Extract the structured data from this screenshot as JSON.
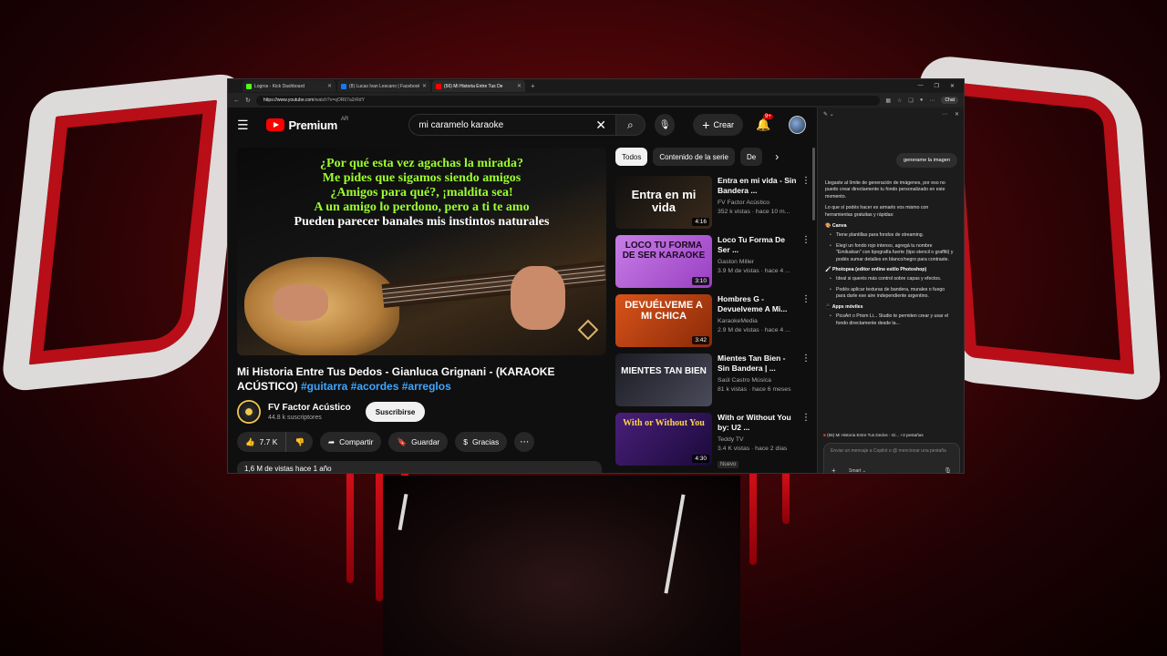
{
  "browser": {
    "tabs": [
      {
        "title": "Logros - Kick Dashboard",
        "favicon_color": "#53fc18",
        "active": false
      },
      {
        "title": "(8) Lucas Ivan Lescano | Facebook",
        "favicon_color": "#1877f2",
        "active": false
      },
      {
        "title": "(56) Mi Historia Entre Tus De",
        "favicon_color": "#ff0000",
        "active": true
      }
    ],
    "url_host": "https://www.youtube.com",
    "url_path": "/watch?v=qOR67a2rRdY",
    "chat_label": "Chat",
    "new_tab": "+"
  },
  "youtube": {
    "logo_word": "Premium",
    "region": "AR",
    "search_value": "mi caramelo karaoke",
    "create_label": "Crear",
    "notifications_badge": "9+",
    "video": {
      "lyrics": [
        {
          "text": "¿Por qué esta vez agachas la mirada?",
          "color": "yellow"
        },
        {
          "text": "Me pides que sigamos siendo amigos",
          "color": "yellow"
        },
        {
          "text": "¿Amigos para qué?, ¡maldita sea!",
          "color": "yellow"
        },
        {
          "text": "A un amigo lo perdono, pero a ti te amo",
          "color": "mixed"
        },
        {
          "text": "Pueden parecer banales mis instintos naturales",
          "color": "white"
        }
      ],
      "title_main": "Mi Historia Entre Tus Dedos - Gianluca Grignani - (KARAOKE ACÚSTICO) ",
      "hashtags": "#guitarra #acordes #arreglos",
      "channel": "FV Factor Acústico",
      "subscribers": "44.8 k suscriptores",
      "subscribe_label": "Suscribirse",
      "likes": "7.7 K",
      "share_label": "Compartir",
      "save_label": "Guardar",
      "thanks_label": "Gracias",
      "views_date": "1,6 M de vistas  hace 1 año"
    },
    "chips": [
      "Todos",
      "Contenido de la serie",
      "De"
    ],
    "recommendations": [
      {
        "title": "Entra en mi vida - Sin Bandera ...",
        "channel": "FV Factor Acústico",
        "meta": "352 k vistas · hace 10 m...",
        "duration": "4:16",
        "thumb_text": "Entra en mi vida",
        "thumb_bg": "#1a1a1a",
        "thumb_fg": "#ffffff"
      },
      {
        "title": "Loco Tu Forma De Ser ...",
        "channel": "Gaston Miller",
        "meta": "3.9 M de vistas · hace 4 ...",
        "duration": "3:10",
        "thumb_text": "LOCO TU FORMA DE SER KARAOKE",
        "thumb_bg": "#b65ad6",
        "thumb_fg": "#1a0a20"
      },
      {
        "title": "Hombres G - Devuelveme A Mi...",
        "channel": "KaraokeMedia",
        "meta": "2.9 M de vistas · hace 4 ...",
        "duration": "3:42",
        "thumb_text": "DEVUÉLVEME A MI CHICA",
        "thumb_bg": "#c2410c",
        "thumb_fg": "#ffffff"
      },
      {
        "title": "Mientes Tan Bien - Sin Bandera | ...",
        "channel": "Saúl Castro Música",
        "meta": "81 k vistas · hace 6 meses",
        "duration": "",
        "thumb_text": "MIENTES TAN BIEN",
        "thumb_bg": "#2a2a35",
        "thumb_fg": "#ffffff"
      },
      {
        "title": "With or Without You by: U2 ...",
        "channel": "Teddy TV",
        "meta": "3.4 K vistas · hace 2 días",
        "duration": "4:30",
        "thumb_text": "With or Without You",
        "thumb_bg": "#3a1a6a",
        "thumb_fg": "#ffd34a",
        "badge": "Nuevo"
      }
    ]
  },
  "copilot": {
    "user_message": "generame la imagen",
    "paragraphs": [
      "Llegaste al límite de generación de imágenes, por eso no puedo crear directamente tu fondo personalizado en este momento.",
      "Lo que sí podés hacer es armarlo vos mismo con herramientas gratuitas y rápidas:"
    ],
    "sections": [
      {
        "heading": "Canva",
        "items": [
          "Tiene plantillas para fondos de streaming.",
          "Elegí un fondo rojo intenso, agregá tu nombre \"Emiluskan\" con tipografía fuerte (tipo stencil o graffiti) y podés sumar detalles en blanco/negro para contraste."
        ]
      },
      {
        "heading": "Photopea (editor online estilo Photoshop)",
        "items": [
          "Ideal si querés más control sobre capas y efectos.",
          "Podés aplicar texturas de bandera, murales o fuego para darle ese aire independiente argentino."
        ]
      },
      {
        "heading": "Apps móviles",
        "items": [
          "PicsArt o Prism Li... Studio te permiten crear y usar el fondo directamente desde la..."
        ]
      }
    ],
    "tab_context": "(56) Mi Historia Entre Tus Dedos - Gi...  +3 pestañas",
    "input_placeholder": "Enviar un mensaje a Copilot o @ mencionar una pestaña",
    "mode_label": "Smart"
  }
}
